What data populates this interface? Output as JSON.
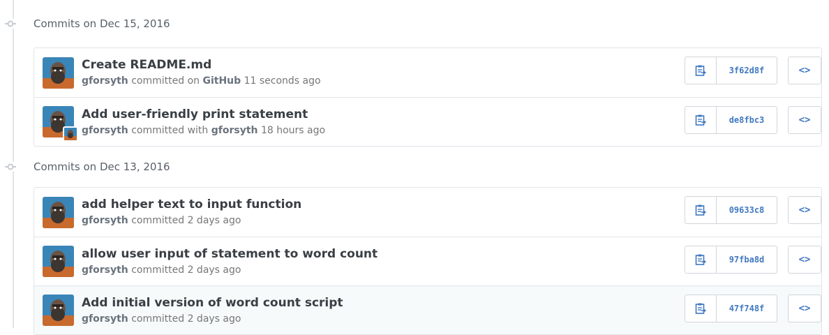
{
  "groups": [
    {
      "title": "Commits on Dec 15, 2016",
      "commits": [
        {
          "title": "Create README.md",
          "author": "gforsyth",
          "verb": "committed on",
          "via": "GitHub",
          "time": "11 seconds ago",
          "sha": "3f62d8f",
          "co_avatar": false
        },
        {
          "title": "Add user-friendly print statement",
          "author": "gforsyth",
          "verb": "committed with",
          "via": "gforsyth",
          "time": "18 hours ago",
          "sha": "de8fbc3",
          "co_avatar": true
        }
      ]
    },
    {
      "title": "Commits on Dec 13, 2016",
      "commits": [
        {
          "title": "add helper text to input function",
          "author": "gforsyth",
          "verb": "committed",
          "via": "",
          "time": "2 days ago",
          "sha": "09633c8",
          "co_avatar": false
        },
        {
          "title": "allow user input of statement to word count",
          "author": "gforsyth",
          "verb": "committed",
          "via": "",
          "time": "2 days ago",
          "sha": "97fba8d",
          "co_avatar": false
        },
        {
          "title": "Add initial version of word count script",
          "author": "gforsyth",
          "verb": "committed",
          "via": "",
          "time": "2 days ago",
          "sha": "47f748f",
          "co_avatar": false
        }
      ]
    }
  ],
  "icons": {
    "copy": "clippy-icon",
    "browse": "code-icon",
    "node": "git-commit-icon"
  },
  "browse_label": "<>",
  "colors": {
    "link": "#4078c0",
    "border": "#e1e4e8",
    "highlight_row": "#f6fafb"
  }
}
